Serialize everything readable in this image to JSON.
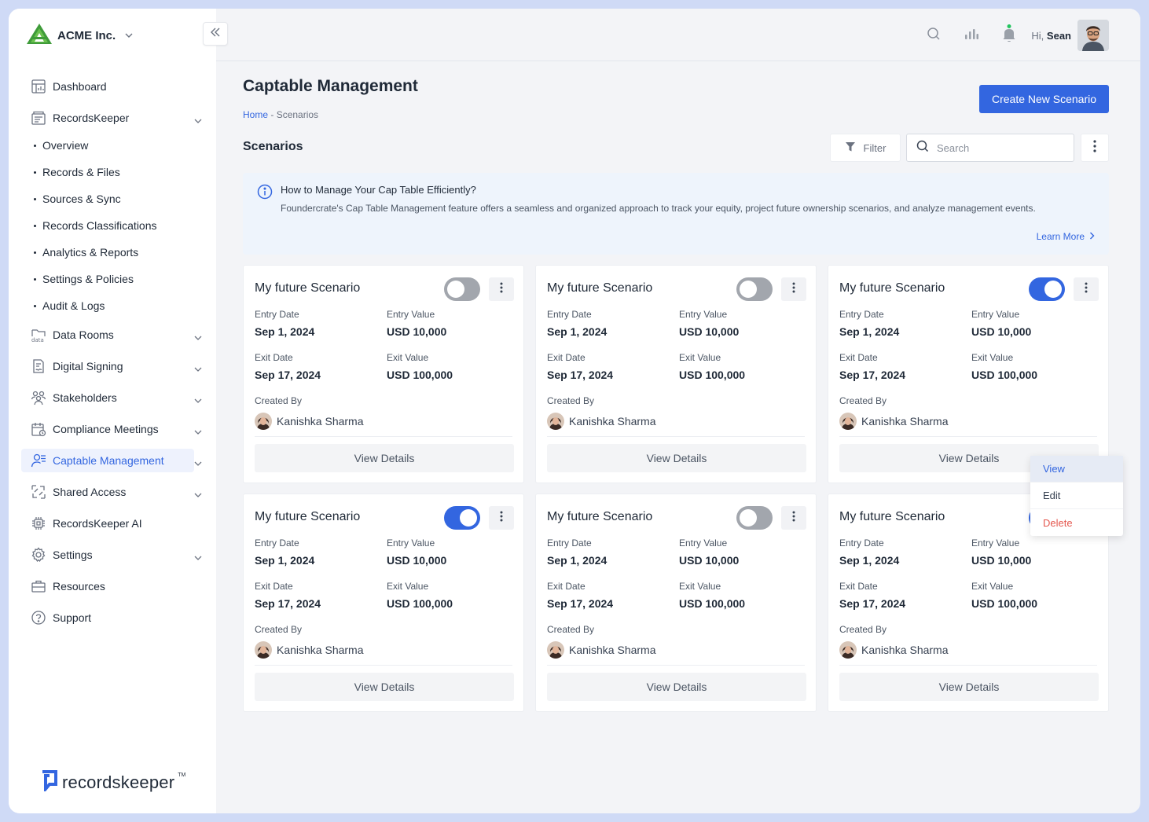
{
  "brand": {
    "name": "ACME Inc."
  },
  "sidebar": {
    "items": [
      {
        "label": "Dashboard",
        "icon": "dashboard-icon"
      },
      {
        "label": "RecordsKeeper",
        "icon": "records-icon",
        "sub": [
          "Overview",
          "Records & Files",
          "Sources & Sync",
          "Records Classifications",
          "Analytics & Reports",
          "Settings & Policies",
          "Audit & Logs"
        ]
      },
      {
        "label": "Data Rooms",
        "icon": "data-room-icon"
      },
      {
        "label": "Digital Signing",
        "icon": "signing-icon"
      },
      {
        "label": "Stakeholders",
        "icon": "stakeholders-icon"
      },
      {
        "label": "Compliance Meetings",
        "icon": "calendar-icon"
      },
      {
        "label": "Captable Management",
        "icon": "captable-icon"
      },
      {
        "label": "Shared Access",
        "icon": "shared-icon"
      },
      {
        "label": "RecordsKeeper AI",
        "icon": "ai-chip-icon"
      },
      {
        "label": "Settings",
        "icon": "gear-icon"
      },
      {
        "label": "Resources",
        "icon": "briefcase-icon"
      },
      {
        "label": "Support",
        "icon": "help-icon"
      }
    ],
    "footer_logo": "recordskeeper",
    "footer_tm": "TM"
  },
  "topbar": {
    "greeting": "Hi,",
    "user": "Sean"
  },
  "page": {
    "title": "Captable Management",
    "breadcrumb_home": "Home",
    "breadcrumb_sep": " - ",
    "breadcrumb_current": "Scenarios",
    "create_label": "Create New Scenario",
    "section_title": "Scenarios",
    "filter_label": "Filter",
    "search_placeholder": "Search"
  },
  "info": {
    "title": "How to Manage Your Cap Table Efficiently?",
    "text": "Foundercrate's Cap Table Management feature offers a seamless and organized approach to track your equity, project future ownership scenarios, and analyze management events.",
    "link": "Learn More"
  },
  "card_labels": {
    "entry_date": "Entry Date",
    "entry_value": "Entry Value",
    "exit_date": "Exit Date",
    "exit_value": "Exit Value",
    "created_by": "Created By",
    "view_details": "View Details"
  },
  "cards": [
    {
      "name": "My future Scenario",
      "enabled": false,
      "entry_date": "Sep 1, 2024",
      "entry_value": "USD 10,000",
      "exit_date": "Sep 17, 2024",
      "exit_value": "USD 100,000",
      "creator": "Kanishka Sharma"
    },
    {
      "name": "My future Scenario",
      "enabled": false,
      "entry_date": "Sep 1, 2024",
      "entry_value": "USD 10,000",
      "exit_date": "Sep 17, 2024",
      "exit_value": "USD 100,000",
      "creator": "Kanishka Sharma"
    },
    {
      "name": "My future Scenario",
      "enabled": true,
      "entry_date": "Sep 1, 2024",
      "entry_value": "USD 10,000",
      "exit_date": "Sep 17, 2024",
      "exit_value": "USD 100,000",
      "creator": "Kanishka Sharma"
    },
    {
      "name": "My future Scenario",
      "enabled": true,
      "entry_date": "Sep 1, 2024",
      "entry_value": "USD 10,000",
      "exit_date": "Sep 17, 2024",
      "exit_value": "USD 100,000",
      "creator": "Kanishka Sharma"
    },
    {
      "name": "My future Scenario",
      "enabled": false,
      "entry_date": "Sep 1, 2024",
      "entry_value": "USD 10,000",
      "exit_date": "Sep 17, 2024",
      "exit_value": "USD 100,000",
      "creator": "Kanishka Sharma"
    },
    {
      "name": "My future Scenario",
      "enabled": true,
      "entry_date": "Sep 1, 2024",
      "entry_value": "USD 10,000",
      "exit_date": "Sep 17, 2024",
      "exit_value": "USD 100,000",
      "creator": "Kanishka Sharma"
    }
  ],
  "menu": {
    "view": "View",
    "edit": "Edit",
    "delete": "Delete"
  },
  "colors": {
    "accent": "#3366e0",
    "danger": "#e4574e",
    "notification_dot": "#22c55e"
  }
}
